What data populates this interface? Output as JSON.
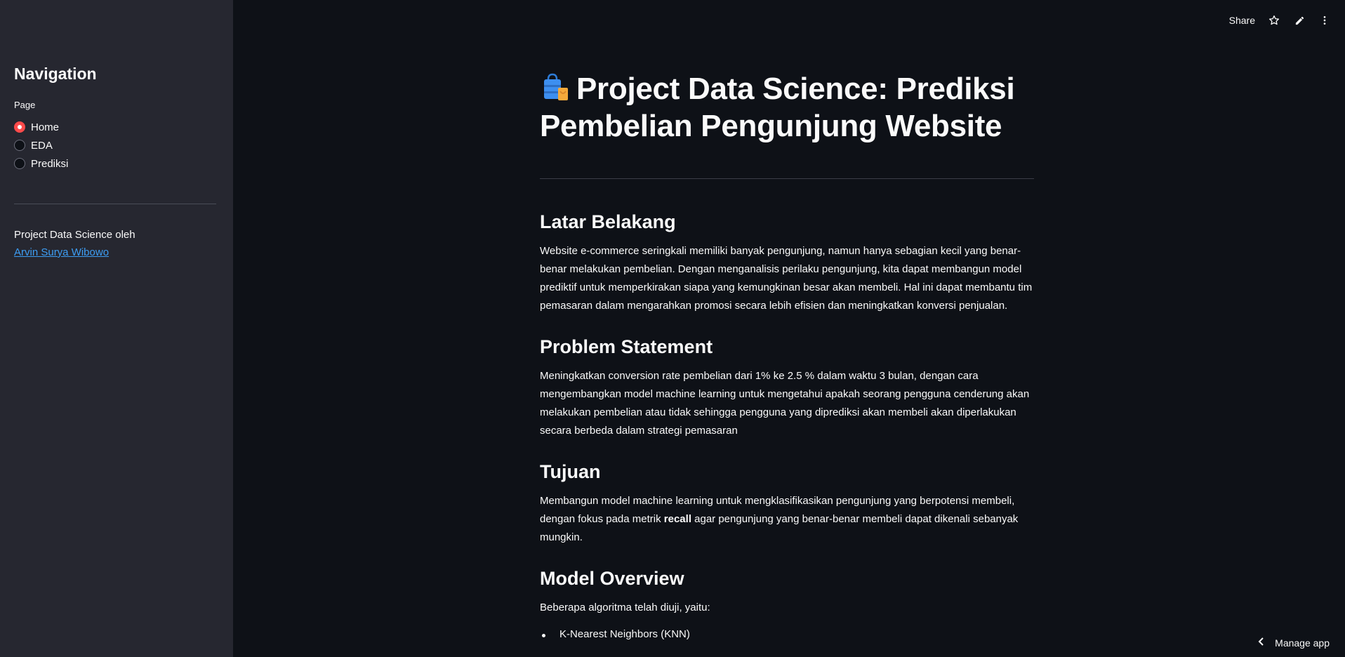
{
  "sidebar": {
    "title": "Navigation",
    "radio_label": "Page",
    "options": [
      "Home",
      "EDA",
      "Prediksi"
    ],
    "selected": "Home",
    "credit_text": "Project Data Science oleh",
    "credit_link": "Arvin Surya Wibowo"
  },
  "toolbar": {
    "share_label": "Share"
  },
  "main": {
    "title": "Project Data Science: Prediksi Pembelian Pengunjung Website",
    "sections": {
      "latar": {
        "heading": "Latar Belakang",
        "text": "Website e-commerce seringkali memiliki banyak pengunjung, namun hanya sebagian kecil yang benar-benar melakukan pembelian. Dengan menganalisis perilaku pengunjung, kita dapat membangun model prediktif untuk memperkirakan siapa yang kemungkinan besar akan membeli. Hal ini dapat membantu tim pemasaran dalam mengarahkan promosi secara lebih efisien dan meningkatkan konversi penjualan."
      },
      "problem": {
        "heading": "Problem Statement",
        "text": "Meningkatkan conversion rate pembelian dari 1% ke 2.5 % dalam waktu 3 bulan, dengan cara mengembangkan model machine learning untuk mengetahui apakah seorang pengguna cenderung akan melakukan pembelian atau tidak sehingga pengguna yang diprediksi akan membeli akan diperlakukan secara berbeda dalam strategi pemasaran"
      },
      "tujuan": {
        "heading": "Tujuan",
        "text_before": "Membangun model machine learning untuk mengklasifikasikan pengunjung yang berpotensi membeli, dengan fokus pada metrik ",
        "text_bold": "recall",
        "text_after": " agar pengunjung yang benar-benar membeli dapat dikenali sebanyak mungkin."
      },
      "model": {
        "heading": "Model Overview",
        "intro": "Beberapa algoritma telah diuji, yaitu:",
        "items": [
          "K-Nearest Neighbors (KNN)"
        ]
      }
    }
  },
  "footer": {
    "manage_label": "Manage app"
  },
  "colors": {
    "background": "#0e1117",
    "sidebar": "#262730",
    "accent": "#ff4b4b",
    "link": "#3d9df3"
  }
}
